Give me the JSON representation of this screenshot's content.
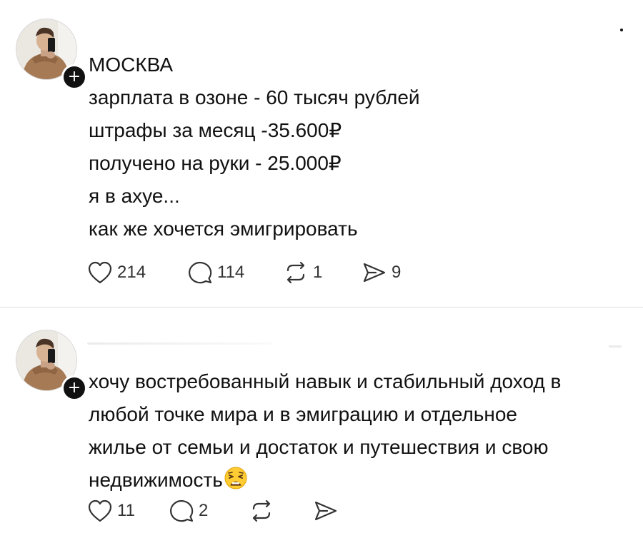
{
  "posts": [
    {
      "lines": [
        "МОСКВА",
        "зарплата в озоне - 60 тысяч рублей",
        "штрафы за месяц -35.600₽",
        "получено на руки - 25.000₽",
        "я в ахуе...",
        "как же хочется эмигрировать"
      ],
      "likes": "214",
      "replies": "114",
      "reposts": "1",
      "shares": "9"
    },
    {
      "lines": [
        "хочу востребованный навык и стабильный доход в",
        "любой точке мира и в эмиграцию и отдельное",
        "жилье от семьи и достаток и путешествия и свою",
        "недвижимость"
      ],
      "emoji": "weary-face-emoji",
      "likes": "11",
      "replies": "2"
    }
  ],
  "badge_symbol": "+",
  "icons": {
    "like": "heart-icon",
    "reply": "comment-icon",
    "repost": "repost-icon",
    "share": "share-icon",
    "more": "more-icon",
    "follow": "plus-icon"
  },
  "colors": {
    "text": "#111111",
    "muted": "#333333",
    "divider": "#e2e2e2",
    "badge": "#111111"
  }
}
